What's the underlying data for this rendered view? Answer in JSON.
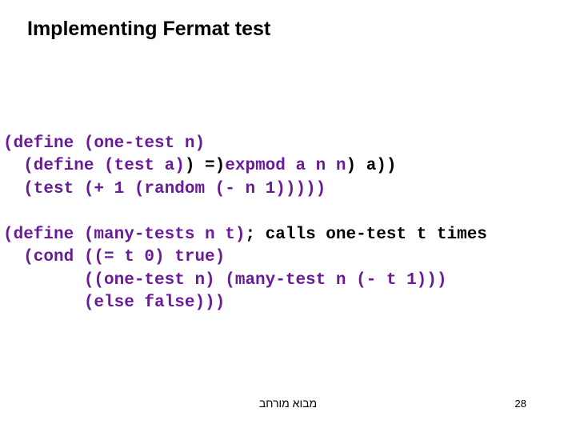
{
  "title": "Implementing Fermat test",
  "code1": {
    "line1": "(define (one-test n)",
    "line2a": "  (define (test a)",
    "line2b": ") =)",
    "line2c": "expmod a n n",
    "line2d": ") a))",
    "line3": "  (test (+ 1 (random (- n 1)))))"
  },
  "code2": {
    "line1a": "(define (many-tests n t)",
    "line1b": "; calls one-test t times",
    "line2": "  (cond ((= t 0) true)",
    "line3": "        ((one-test n) (many-test n (- t 1)))",
    "line4": "        (else false)))"
  },
  "footer": "מבוא מורחב",
  "pageNumber": "28"
}
